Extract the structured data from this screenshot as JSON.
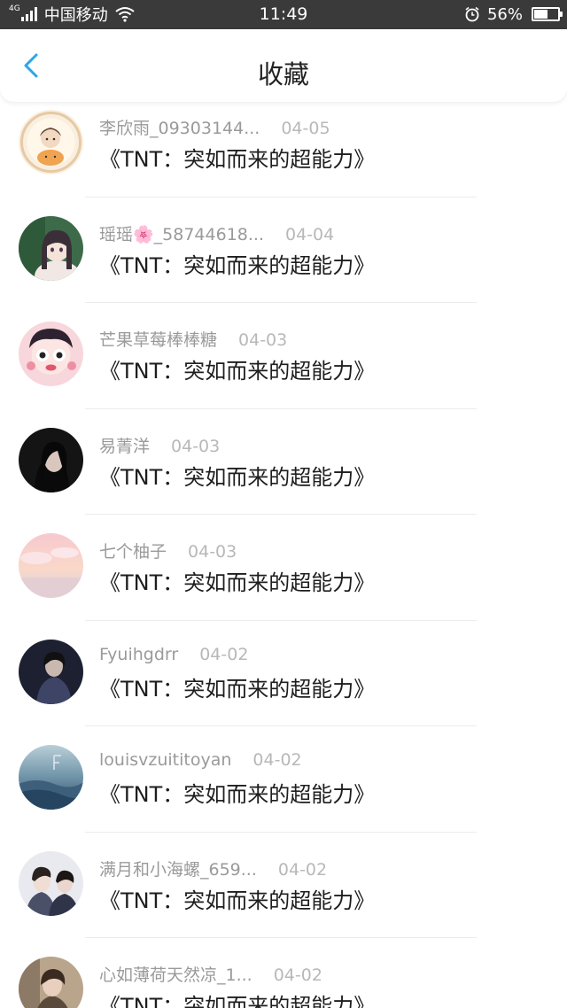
{
  "status_bar": {
    "network": "4G",
    "carrier": "中国移动",
    "time": "11:49",
    "battery_text": "56%",
    "battery_level": 0.56,
    "icons": [
      "signal-icon",
      "wifi-icon",
      "alarm-icon",
      "battery-icon"
    ]
  },
  "header": {
    "title": "收藏",
    "back_icon": "chevron-left-icon",
    "accent": "#2aa5ec"
  },
  "favorites": [
    {
      "user": "李欣雨_09303144...",
      "date": "04-05",
      "work": "《TNT：突如而来的超能力》"
    },
    {
      "user": "瑶瑶🌸_58744618...",
      "date": "04-04",
      "work": "《TNT：突如而来的超能力》"
    },
    {
      "user": "芒果草莓棒棒糖",
      "date": "04-03",
      "work": "《TNT：突如而来的超能力》"
    },
    {
      "user": "易菁洋",
      "date": "04-03",
      "work": "《TNT：突如而来的超能力》"
    },
    {
      "user": "七个柚子",
      "date": "04-03",
      "work": "《TNT：突如而来的超能力》"
    },
    {
      "user": "Fyuihgdrr",
      "date": "04-02",
      "work": "《TNT：突如而来的超能力》"
    },
    {
      "user": "louisvzuititoyan",
      "date": "04-02",
      "work": "《TNT：突如而来的超能力》"
    },
    {
      "user": "满月和小海螺_659...",
      "date": "04-02",
      "work": "《TNT：突如而来的超能力》"
    },
    {
      "user": "心如薄荷天然凉_1...",
      "date": "04-02",
      "work": "《TNT：突如而来的超能力》"
    }
  ]
}
